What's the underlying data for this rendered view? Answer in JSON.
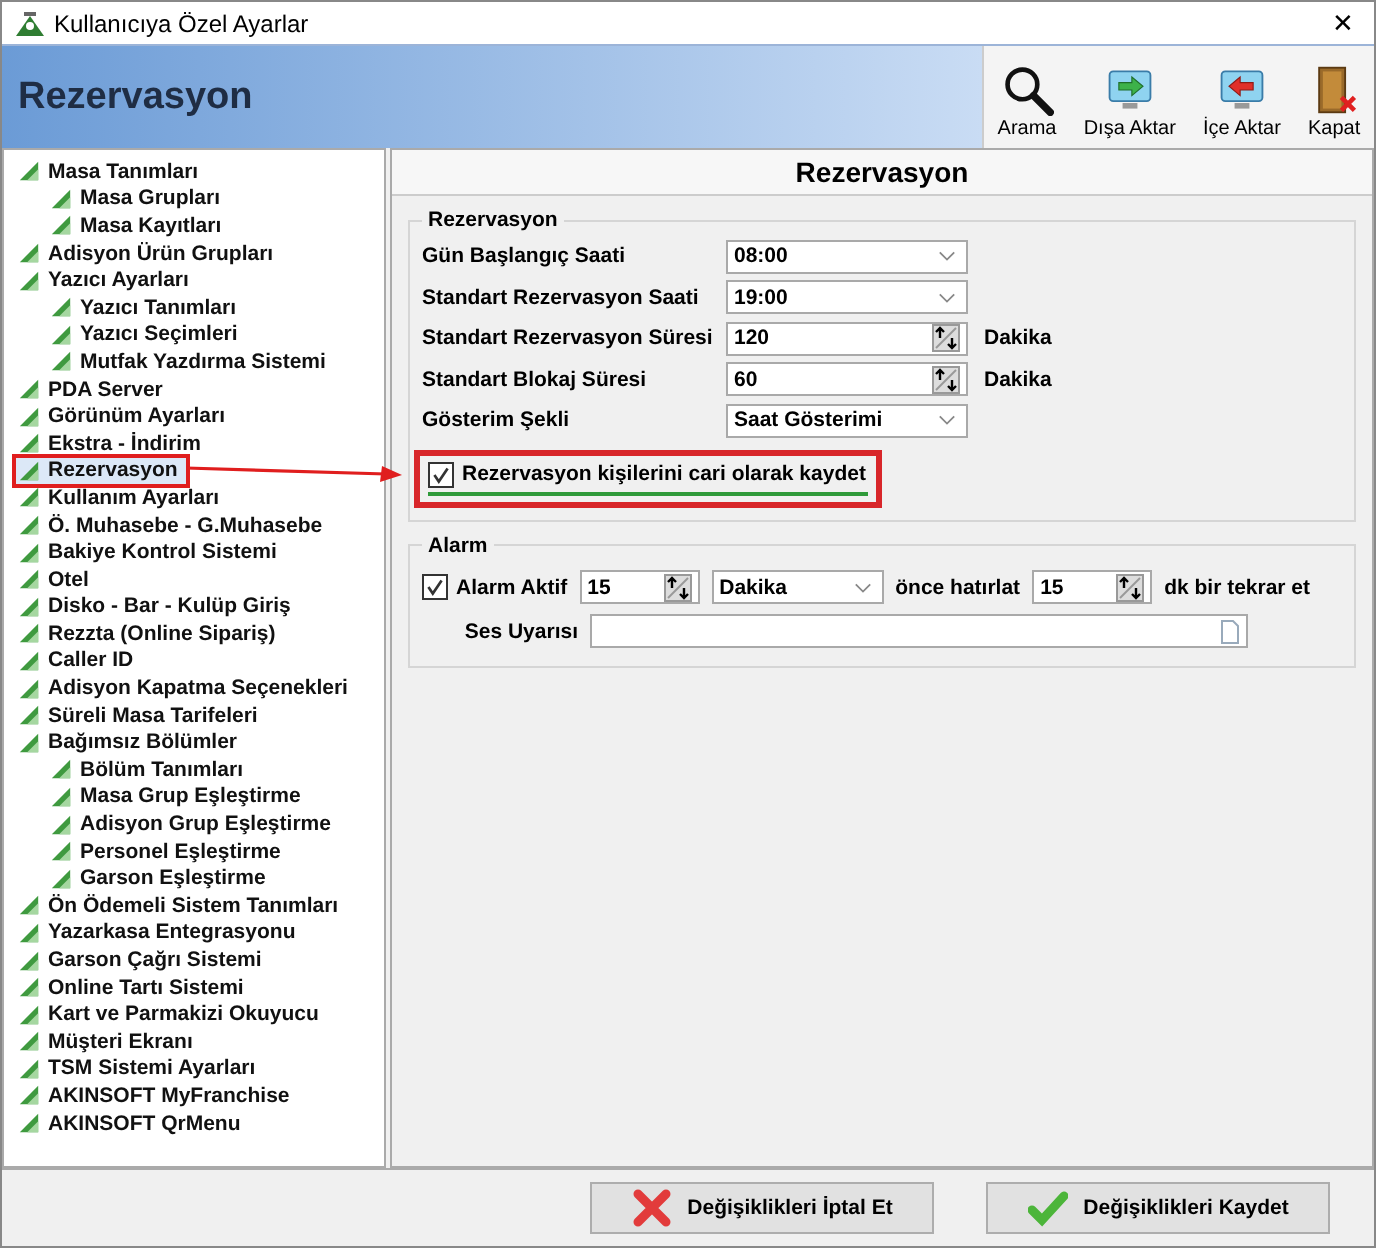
{
  "window": {
    "title": "Kullanıcıya Özel Ayarlar",
    "close": "✕"
  },
  "header": {
    "title": "Rezervasyon"
  },
  "toolbar": [
    {
      "kind": "search",
      "label": "Arama"
    },
    {
      "kind": "export",
      "label": "Dışa Aktar"
    },
    {
      "kind": "import",
      "label": "İçe Aktar"
    },
    {
      "kind": "exit",
      "label": "Kapat"
    }
  ],
  "tree": [
    {
      "label": "Masa Tanımları",
      "selected": false,
      "children": [
        {
          "label": "Masa Grupları",
          "selected": false
        },
        {
          "label": "Masa Kayıtları",
          "selected": false
        }
      ]
    },
    {
      "label": "Adisyon Ürün Grupları",
      "selected": false
    },
    {
      "label": "Yazıcı Ayarları",
      "selected": false,
      "children": [
        {
          "label": "Yazıcı Tanımları",
          "selected": false
        },
        {
          "label": "Yazıcı Seçimleri",
          "selected": false
        },
        {
          "label": "Mutfak Yazdırma Sistemi",
          "selected": false
        }
      ]
    },
    {
      "label": "PDA Server",
      "selected": false
    },
    {
      "label": "Görünüm Ayarları",
      "selected": false
    },
    {
      "label": "Ekstra - İndirim",
      "selected": false
    },
    {
      "label": "Rezervasyon",
      "selected": true
    },
    {
      "label": "Kullanım Ayarları",
      "selected": false
    },
    {
      "label": "Ö. Muhasebe - G.Muhasebe",
      "selected": false
    },
    {
      "label": "Bakiye Kontrol Sistemi",
      "selected": false
    },
    {
      "label": "Otel",
      "selected": false
    },
    {
      "label": "Disko - Bar - Kulüp Giriş",
      "selected": false
    },
    {
      "label": "Rezzta (Online Sipariş)",
      "selected": false
    },
    {
      "label": "Caller ID",
      "selected": false
    },
    {
      "label": "Adisyon Kapatma Seçenekleri",
      "selected": false
    },
    {
      "label": "Süreli Masa Tarifeleri",
      "selected": false
    },
    {
      "label": "Bağımsız Bölümler",
      "selected": false,
      "children": [
        {
          "label": "Bölüm Tanımları",
          "selected": false
        },
        {
          "label": "Masa Grup Eşleştirme",
          "selected": false
        },
        {
          "label": "Adisyon Grup Eşleştirme",
          "selected": false
        },
        {
          "label": "Personel Eşleştirme",
          "selected": false
        },
        {
          "label": "Garson Eşleştirme",
          "selected": false
        }
      ]
    },
    {
      "label": "Ön Ödemeli Sistem Tanımları",
      "selected": false
    },
    {
      "label": "Yazarkasa Entegrasyonu",
      "selected": false
    },
    {
      "label": "Garson Çağrı Sistemi",
      "selected": false
    },
    {
      "label": "Online Tartı Sistemi",
      "selected": false
    },
    {
      "label": "Kart ve Parmakizi Okuyucu",
      "selected": false
    },
    {
      "label": "Müşteri Ekranı",
      "selected": false
    },
    {
      "label": "TSM Sistemi Ayarları",
      "selected": false
    },
    {
      "label": "AKINSOFT MyFranchise",
      "selected": false
    },
    {
      "label": "AKINSOFT QrMenu",
      "selected": false
    }
  ],
  "panel": {
    "title": "Rezervasyon",
    "group": {
      "title": "Rezervasyon",
      "fields": [
        {
          "kind": "dropdown",
          "label": "Gün Başlangıç Saati",
          "value": "08:00"
        },
        {
          "kind": "dropdown",
          "label": "Standart Rezervasyon Saati",
          "value": "19:00"
        },
        {
          "kind": "spinner",
          "label": "Standart Rezervasyon Süresi",
          "value": "120",
          "unit": "Dakika"
        },
        {
          "kind": "spinner",
          "label": "Standart Blokaj Süresi",
          "value": "60",
          "unit": "Dakika"
        },
        {
          "kind": "dropdown",
          "label": "Gösterim Şekli",
          "value": "Saat Gösterimi"
        }
      ],
      "checkbox": {
        "label": "Rezervasyon kişilerini cari olarak kaydet",
        "checked": true,
        "highlighted": true
      }
    },
    "alarm": {
      "title": "Alarm",
      "active": {
        "label": "Alarm Aktif",
        "checked": true
      },
      "before": "15",
      "unit": "Dakika",
      "before_text": "önce hatırlat",
      "repeat": "15",
      "repeat_text": "dk bir tekrar et",
      "sound_label": "Ses Uyarısı"
    }
  },
  "buttons": [
    {
      "kind": "cancel",
      "label": "Değişiklikleri İptal Et"
    },
    {
      "kind": "save",
      "label": "Değişiklikleri Kaydet"
    }
  ]
}
